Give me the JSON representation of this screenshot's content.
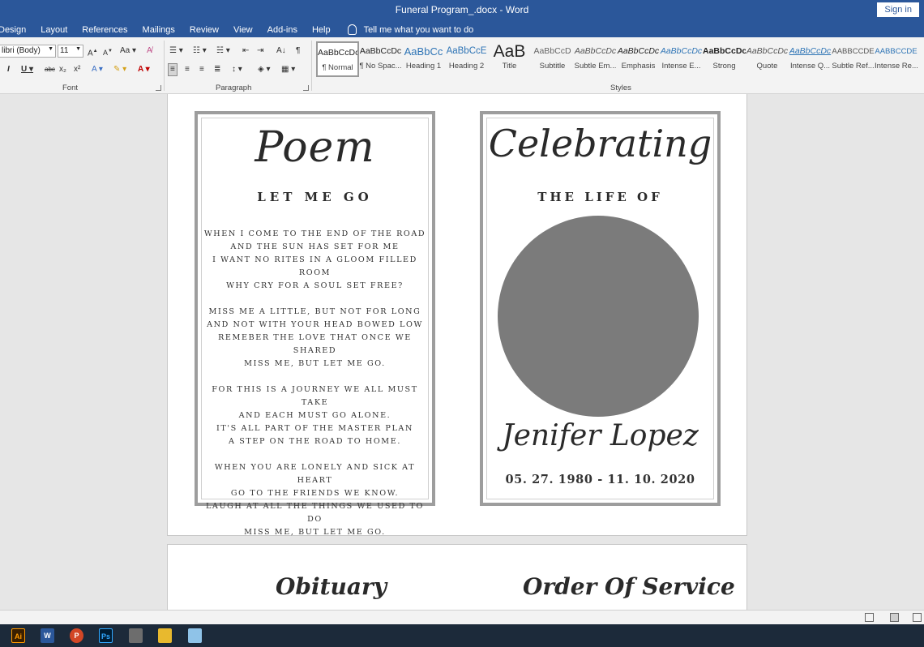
{
  "window": {
    "title": "Funeral Program_.docx  -  Word",
    "signin_label": "Sign in"
  },
  "menu": {
    "items": [
      "Design",
      "Layout",
      "References",
      "Mailings",
      "Review",
      "View",
      "Add-ins",
      "Help"
    ],
    "tell_me": "Tell me what you want to do"
  },
  "ribbon": {
    "font": {
      "name": "libri (Body)",
      "size": "11",
      "group_label": "Font"
    },
    "paragraph": {
      "group_label": "Paragraph"
    },
    "styles": {
      "group_label": "Styles",
      "items": [
        {
          "sample": "AaBbCcDc",
          "name": "¶ Normal"
        },
        {
          "sample": "AaBbCcDc",
          "name": "¶ No Spac..."
        },
        {
          "sample": "AaBbCc",
          "name": "Heading 1"
        },
        {
          "sample": "AaBbCcE",
          "name": "Heading 2"
        },
        {
          "sample": "AaB",
          "name": "Title"
        },
        {
          "sample": "AaBbCcD",
          "name": "Subtitle"
        },
        {
          "sample": "AaBbCcDc",
          "name": "Subtle Em..."
        },
        {
          "sample": "AaBbCcDc",
          "name": "Emphasis"
        },
        {
          "sample": "AaBbCcDc",
          "name": "Intense E..."
        },
        {
          "sample": "AaBbCcDc",
          "name": "Strong"
        },
        {
          "sample": "AaBbCcDc",
          "name": "Quote"
        },
        {
          "sample": "AaBbCcDc",
          "name": "Intense Q..."
        },
        {
          "sample": "AABBCCDE",
          "name": "Subtle Ref..."
        },
        {
          "sample": "AABBCCDE",
          "name": "Intense Re..."
        }
      ]
    }
  },
  "document": {
    "poem_card": {
      "script_title": "Poem",
      "heading": "LET ME GO",
      "stanzas": [
        [
          "WHEN I COME TO THE END OF THE ROAD",
          "AND THE SUN HAS SET FOR ME",
          "I WANT NO RITES IN A GLOOM FILLED ROOM",
          "WHY CRY FOR A SOUL SET FREE?"
        ],
        [
          "MISS ME A LITTLE, BUT NOT FOR LONG",
          "AND NOT WITH YOUR HEAD BOWED LOW",
          "REMEBER THE LOVE THAT ONCE WE SHARED",
          "MISS ME, BUT LET ME GO."
        ],
        [
          "FOR THIS IS A JOURNEY WE ALL MUST TAKE",
          "AND EACH MUST GO ALONE.",
          "IT'S ALL PART OF THE MASTER PLAN",
          "A STEP ON THE ROAD TO HOME."
        ],
        [
          "WHEN YOU ARE LONELY AND SICK AT HEART",
          "GO TO THE FRIENDS WE KNOW.",
          "LAUGH AT ALL THE THINGS WE USED TO DO",
          "MISS ME, BUT LET ME GO."
        ]
      ]
    },
    "cover_card": {
      "script_title": "Celebrating",
      "subtitle": "THE LIFE OF",
      "name": "Jenifer Lopez",
      "dates": "05. 27. 1980 - 11. 10. 2020"
    },
    "page2": {
      "obituary": "Obituary",
      "order_of_service": "Order Of Service"
    }
  },
  "taskbar": {
    "apps": [
      {
        "label": "Ai",
        "color": "#3a1f00",
        "fg": "#ff9a00"
      },
      {
        "label": "W",
        "color": "#2b579a",
        "fg": "#ffffff"
      },
      {
        "label": "P",
        "color": "#d24726",
        "fg": "#ffffff"
      },
      {
        "label": "Ps",
        "color": "#001d34",
        "fg": "#31a8ff"
      },
      {
        "label": "",
        "color": "#6d6d6d",
        "fg": "#ffffff"
      },
      {
        "label": "",
        "color": "#e8b92e",
        "fg": "#ffffff"
      },
      {
        "label": "",
        "color": "#8fc3e8",
        "fg": "#ffffff"
      }
    ]
  }
}
